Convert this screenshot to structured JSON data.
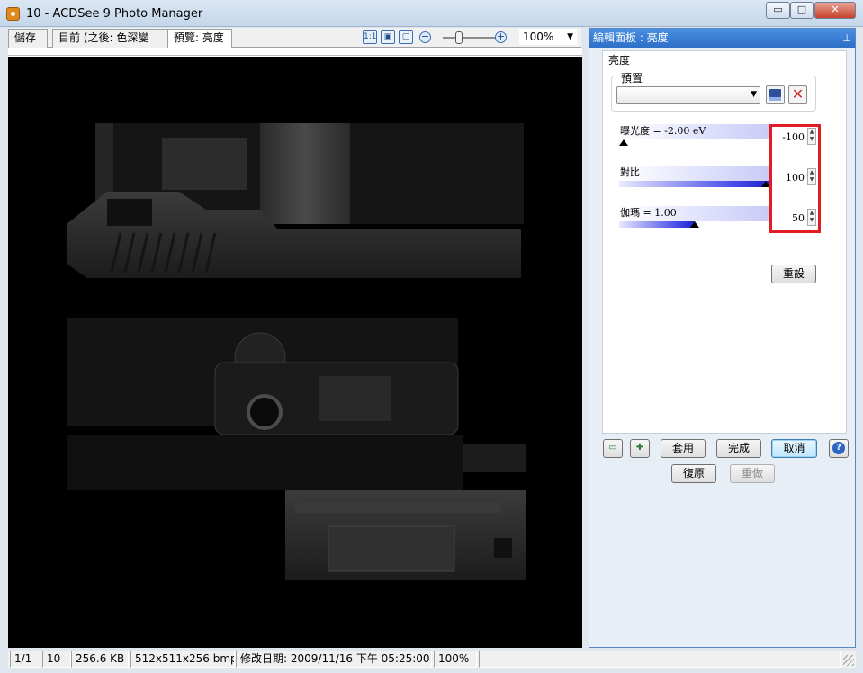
{
  "window": {
    "title": "10 - ACDSee 9 Photo Manager",
    "minimize": "▭",
    "maximize": "□",
    "close": "✕"
  },
  "toolbar": {
    "tabs": [
      "儲存",
      "目前 (之後: 色深變更)",
      "預覽: 亮度"
    ],
    "icons": [
      "one-to-one-icon",
      "fit-image-icon",
      "fit-window-icon"
    ],
    "icon_text": [
      "1:1",
      "▣",
      "▢"
    ],
    "zoom_out": "−",
    "zoom_in": "+",
    "zoom_value": "100%",
    "zoom_dropdown": "▼"
  },
  "panel": {
    "title": "編輯面板 : 亮度",
    "pin": "⊥",
    "section": "亮度",
    "preset": {
      "label": "預置",
      "selected": ""
    },
    "sliders": [
      {
        "label": "曝光度 = -2.00 eV",
        "value": "-100",
        "fraction": 0.0
      },
      {
        "label": "對比",
        "value": "100",
        "fraction": 1.0
      },
      {
        "label": "伽瑪 = 1.00",
        "value": "50",
        "fraction": 0.5
      }
    ],
    "reset_label": "重設",
    "buttons": {
      "apply": "套用",
      "done": "完成",
      "cancel": "取消",
      "undo": "復原",
      "redo": "重做"
    },
    "left_icons": [
      "compare-icon",
      "add-effect-icon"
    ],
    "highlight_color": "#e01c24"
  },
  "statusbar": {
    "position": "1/1",
    "index": "10",
    "filesize": "256.6 KB",
    "dimensions": "512x511x256 bmp",
    "modified": "修改日期: 2009/11/16 下午 05:25:00",
    "zoom": "100%",
    "extra": ""
  }
}
